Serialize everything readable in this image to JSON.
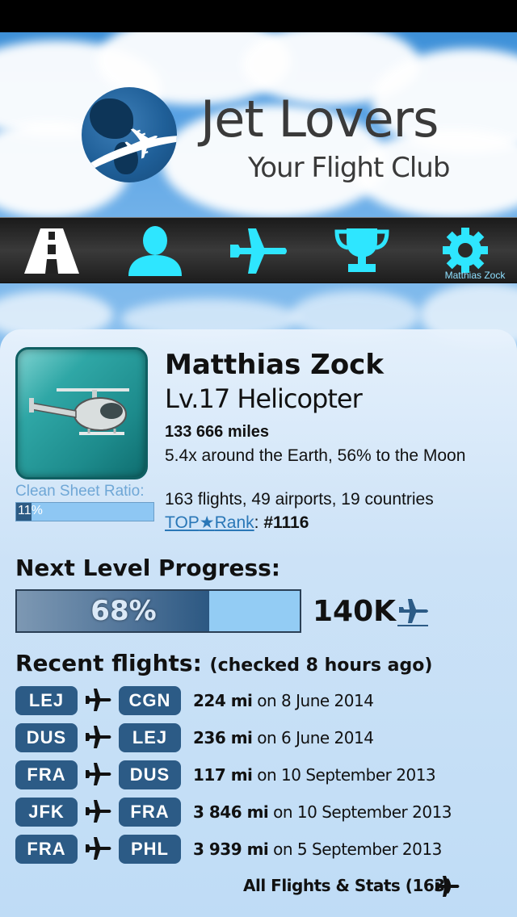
{
  "header": {
    "title": "Jet Lovers",
    "subtitle": "Your Flight Club"
  },
  "nav": {
    "items": [
      {
        "name": "road",
        "icon": "road-icon"
      },
      {
        "name": "profile",
        "icon": "person-icon"
      },
      {
        "name": "flights",
        "icon": "airplane-icon"
      },
      {
        "name": "trophy",
        "icon": "trophy-icon"
      },
      {
        "name": "settings",
        "icon": "gear-icon"
      }
    ],
    "user_label": "Matthias Zock"
  },
  "profile": {
    "name": "Matthias Zock",
    "level": "Lv.17 Helicopter",
    "miles": "133 666 miles",
    "around": "5.4x around the Earth, 56% to the Moon",
    "stats": "163 flights, 49 airports, 19 countries",
    "rank_link_pre": "TOP",
    "rank_link_post": "Rank",
    "rank_sep": ": ",
    "rank_value": "#1116",
    "clean_sheet_label": "Clean Sheet Ratio:",
    "clean_sheet_text": "11%",
    "clean_sheet_value": 0.11
  },
  "progress": {
    "label": "Next Level Progress:",
    "text": "68%",
    "value": 0.68,
    "target": "140K"
  },
  "recent": {
    "label": "Recent flights:",
    "checked": "(checked 8 hours ago)",
    "flights": [
      {
        "from": "LEJ",
        "to": "CGN",
        "miles": "224 mi",
        "date": "on 8 June 2014"
      },
      {
        "from": "DUS",
        "to": "LEJ",
        "miles": "236 mi",
        "date": "on 6 June 2014"
      },
      {
        "from": "FRA",
        "to": "DUS",
        "miles": "117 mi",
        "date": "on 10 September 2013"
      },
      {
        "from": "JFK",
        "to": "FRA",
        "miles": "3 846 mi",
        "date": "on 10 September 2013"
      },
      {
        "from": "FRA",
        "to": "PHL",
        "miles": "3 939 mi",
        "date": "on 5 September 2013"
      }
    ],
    "all_link": "All Flights & Stats (163)"
  },
  "colors": {
    "accent": "#2ee6ff",
    "pill": "#2c5b86",
    "nav_bg": "#2a2a2a"
  }
}
